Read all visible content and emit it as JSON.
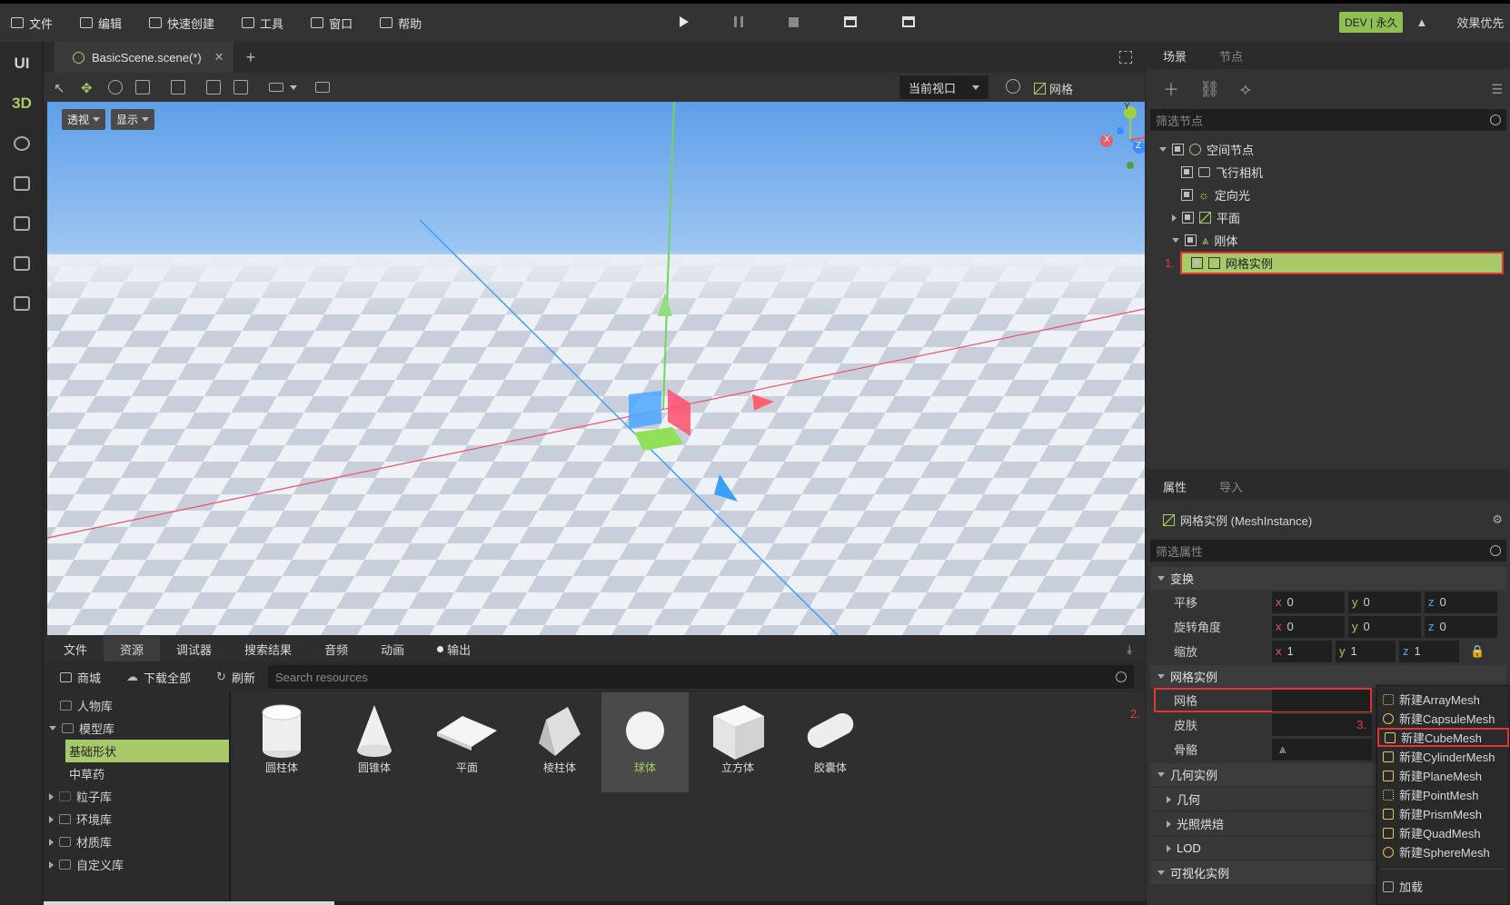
{
  "menu": {
    "items": [
      {
        "label": "文件",
        "icon": "folder-icon"
      },
      {
        "label": "编辑",
        "icon": "crop-icon"
      },
      {
        "label": "快速创建",
        "icon": "edit-icon"
      },
      {
        "label": "工具",
        "icon": "toolbox-icon"
      },
      {
        "label": "窗口",
        "icon": "window-icon"
      },
      {
        "label": "帮助",
        "icon": "help-book-icon"
      }
    ],
    "dev_badge": "DEV | 永久",
    "quality": "效果优先"
  },
  "left_rail": {
    "ui_label": "UI",
    "threed_label": "3D",
    "items": [
      "path-icon",
      "store-icon",
      "build-icon",
      "export-icon",
      "import-icon"
    ]
  },
  "doc_tab": {
    "label": "BasicScene.scene(*)",
    "add": "+"
  },
  "toolbar": {
    "viewport_select": "当前视口",
    "grid_label": "网格"
  },
  "viewport": {
    "perspective_btn": "透视",
    "display_btn": "显示",
    "gizmo": {
      "y": "Y",
      "x": "X",
      "z": "Z"
    }
  },
  "bottom_tabs": [
    "文件",
    "资源",
    "调试器",
    "搜索结果",
    "音频",
    "动画",
    "输出"
  ],
  "bottom_active": "资源",
  "res_toolbar": {
    "store": "商城",
    "download_all": "下载全部",
    "refresh": "刷新",
    "search_placeholder": "Search resources"
  },
  "library": [
    {
      "label": "人物库",
      "state": "none"
    },
    {
      "label": "模型库",
      "state": "open"
    },
    {
      "label": "基础形状",
      "state": "selected"
    },
    {
      "label": "中草药",
      "state": "child"
    },
    {
      "label": "粒子库",
      "state": "closed"
    },
    {
      "label": "环境库",
      "state": "closed"
    },
    {
      "label": "材质库",
      "state": "closed"
    },
    {
      "label": "自定义库",
      "state": "closed"
    }
  ],
  "assets": [
    {
      "label": "圆柱体",
      "shape": "cylinder"
    },
    {
      "label": "圆锥体",
      "shape": "cone"
    },
    {
      "label": "平面",
      "shape": "plane"
    },
    {
      "label": "棱柱体",
      "shape": "prism"
    },
    {
      "label": "球体",
      "shape": "sphere",
      "selected": true
    },
    {
      "label": "立方体",
      "shape": "cube"
    },
    {
      "label": "胶囊体",
      "shape": "capsule"
    }
  ],
  "scene_panel": {
    "tabs": [
      "场景",
      "节点"
    ],
    "filter_placeholder": "筛选节点",
    "nodes": [
      {
        "label": "空间节点",
        "icon": "spatial-circle-icon"
      },
      {
        "label": "飞行相机",
        "icon": "camera-icon"
      },
      {
        "label": "定向光",
        "icon": "sun-icon"
      },
      {
        "label": "平面",
        "icon": "mesh-icon"
      },
      {
        "label": "刚体",
        "icon": "rigidbody-icon"
      },
      {
        "label": "网格实例",
        "icon": "mesh-icon"
      }
    ],
    "step1": "1."
  },
  "prop_panel": {
    "tabs": [
      "属性",
      "导入"
    ],
    "header": "网格实例 (MeshInstance)",
    "filter_placeholder": "筛选属性",
    "section_transform": "变换",
    "translate": {
      "label": "平移",
      "x": "0",
      "y": "0",
      "z": "0"
    },
    "rotate": {
      "label": "旋转角度",
      "x": "0",
      "y": "0",
      "z": "0"
    },
    "scale": {
      "label": "缩放",
      "x": "1",
      "y": "1",
      "z": "1"
    },
    "section_mesh": "网格实例",
    "mesh_label": "网格",
    "skin_label": "皮肤",
    "skeleton_label": "骨骼",
    "step2": "2.",
    "step3": "3.",
    "section_geometry": "几何实例",
    "geometry": "几何",
    "lightbake": "光照烘焙",
    "lod": "LOD",
    "section_visual": "可视化实例"
  },
  "popup_menu": [
    "新建ArrayMesh",
    "新建CapsuleMesh",
    "新建CubeMesh",
    "新建CylinderMesh",
    "新建PlaneMesh",
    "新建PointMesh",
    "新建PrismMesh",
    "新建QuadMesh",
    "新建SphereMesh"
  ],
  "popup_load": "加载",
  "colors": {
    "accent": "#a7c96a",
    "highlight_red": "#e23535"
  }
}
